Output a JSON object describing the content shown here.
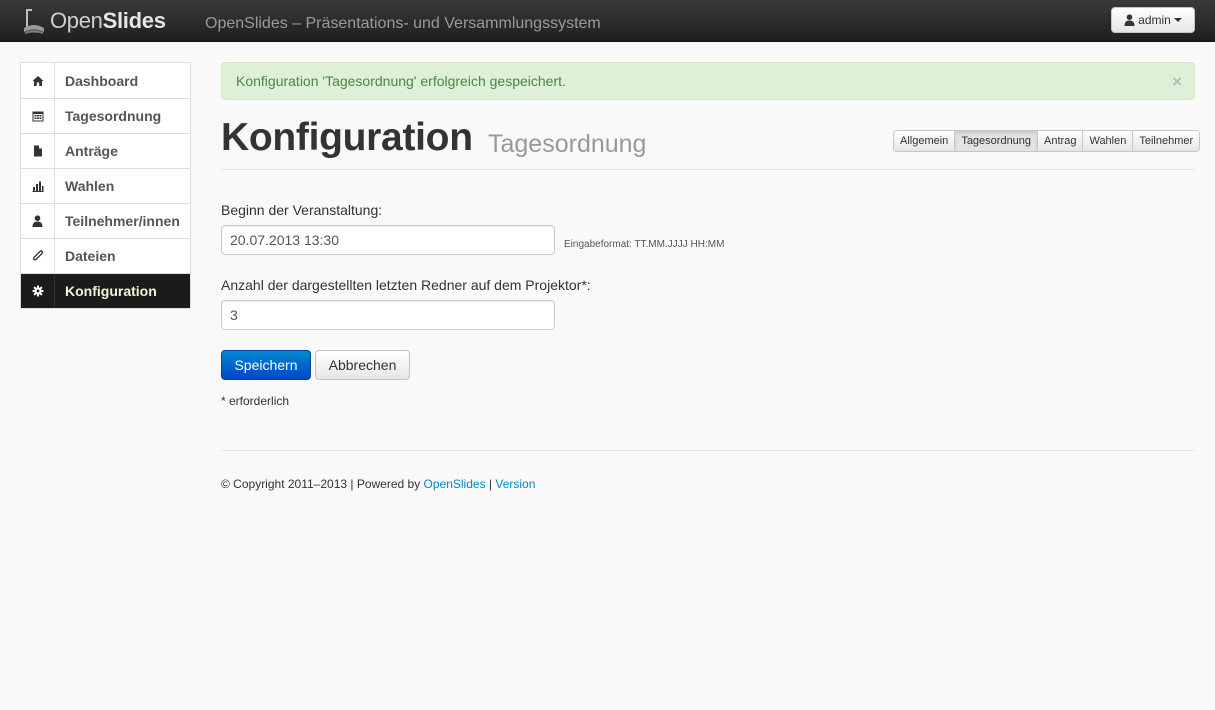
{
  "navbar": {
    "brand_prefix": "Open",
    "brand_bold": "Slides",
    "title": "OpenSlides – Präsentations- und Versammlungssystem",
    "user_label": "admin"
  },
  "sidebar": {
    "items": [
      {
        "label": "Dashboard",
        "icon": "home-icon"
      },
      {
        "label": "Tagesordnung",
        "icon": "calendar-icon"
      },
      {
        "label": "Anträge",
        "icon": "file-icon"
      },
      {
        "label": "Wahlen",
        "icon": "bar-chart-icon"
      },
      {
        "label": "Teilnehmer/innen",
        "icon": "user-icon"
      },
      {
        "label": "Dateien",
        "icon": "paperclip-icon"
      },
      {
        "label": "Konfiguration",
        "icon": "gear-icon",
        "active": true
      }
    ]
  },
  "alert": {
    "message": "Konfiguration 'Tagesordnung' erfolgreich gespeichert.",
    "close": "×"
  },
  "header": {
    "title": "Konfiguration",
    "subtitle": "Tagesordnung",
    "tabs": [
      {
        "label": "Allgemein"
      },
      {
        "label": "Tagesordnung",
        "active": true
      },
      {
        "label": "Antrag"
      },
      {
        "label": "Wahlen"
      },
      {
        "label": "Teilnehmer"
      }
    ]
  },
  "form": {
    "start_label": "Beginn der Veranstaltung:",
    "start_value": "20.07.2013 13:30",
    "start_help": "Eingabeformat: TT.MM.JJJJ HH:MM",
    "speakers_label": "Anzahl der dargestellten letzten Redner auf dem Projektor*:",
    "speakers_value": "3",
    "save_label": "Speichern",
    "cancel_label": "Abbrechen",
    "required_note": "* erforderlich"
  },
  "footer": {
    "copyright": "© Copyright 2011–2013 | Powered by ",
    "openslides_link": "OpenSlides",
    "separator": " | ",
    "version_link": "Version"
  },
  "colors": {
    "primary": "#0088cc",
    "alert_bg": "#dff0d8",
    "alert_text": "#468847",
    "sidebar_active_bg": "#1b1b1b"
  }
}
